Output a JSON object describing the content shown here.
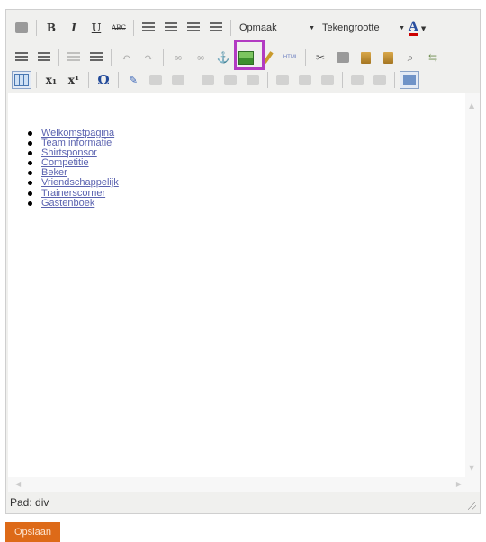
{
  "toolbar": {
    "row1": {
      "bold_label": "B",
      "italic_label": "I",
      "underline_label": "U",
      "strike_label": "ABC",
      "format_select_value": "Opmaak",
      "fontsize_select_value": "Tekengrootte",
      "fontcolor_label": "A"
    },
    "row2": {
      "html_label": "HTML"
    },
    "row3": {
      "special_char_label": "Ω",
      "subscript_label": "x₁",
      "superscript_label": "x¹"
    }
  },
  "icons": [
    "print-icon",
    "bold-icon",
    "italic-icon",
    "underline-icon",
    "strikethrough-icon",
    "align-left-icon",
    "align-center-icon",
    "align-right-icon",
    "align-justify-icon",
    "bullet-list-icon",
    "numbered-list-icon",
    "outdent-icon",
    "indent-icon",
    "undo-icon",
    "redo-icon",
    "link-icon",
    "unlink-icon",
    "anchor-icon",
    "image-icon",
    "cleanup-icon",
    "html-icon",
    "cut-icon",
    "copy-icon",
    "paste-icon",
    "paste-word-icon",
    "find-icon",
    "replace-icon",
    "table-icon",
    "subscript-icon",
    "superscript-icon",
    "special-char-icon",
    "edit-icon",
    "fullscreen-icon"
  ],
  "content": {
    "links": [
      "Welkomstpagina",
      "Team informatie",
      "Shirtsponsor",
      "Competitie",
      "Beker",
      "Vriendschappelijk",
      "Trainerscorner",
      "Gastenboek"
    ]
  },
  "status": {
    "path": "Pad: div"
  },
  "actions": {
    "save_label": "Opslaan"
  },
  "colors": {
    "highlight": "#b23bc2",
    "save_button": "#dd6a18",
    "link": "#5b63b0"
  }
}
